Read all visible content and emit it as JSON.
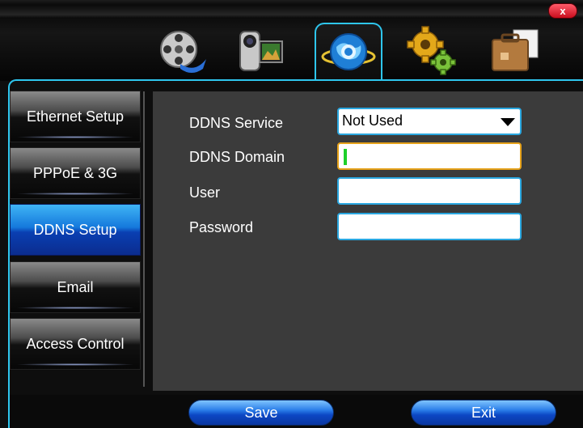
{
  "window": {
    "close_label": "x",
    "tabs": [
      {
        "name": "film-reel-icon",
        "active": false
      },
      {
        "name": "video-camera-icon",
        "active": false
      },
      {
        "name": "globe-network-icon",
        "active": true
      },
      {
        "name": "gears-icon",
        "active": false
      },
      {
        "name": "briefcase-icon",
        "active": false
      }
    ]
  },
  "sidebar": {
    "items": [
      {
        "label": "Ethernet Setup",
        "active": false
      },
      {
        "label": "PPPoE & 3G",
        "active": false
      },
      {
        "label": "DDNS Setup",
        "active": true
      },
      {
        "label": "Email",
        "active": false
      },
      {
        "label": "Access Control",
        "active": false
      }
    ]
  },
  "form": {
    "service_label": "DDNS Service",
    "service_value": "Not Used",
    "domain_label": "DDNS Domain",
    "domain_value": "",
    "user_label": "User",
    "user_value": "",
    "password_label": "Password",
    "password_value": ""
  },
  "actions": {
    "save_label": "Save",
    "exit_label": "Exit"
  },
  "colors": {
    "accent_cyan": "#2ec6ee",
    "active_blue": "#1579dc",
    "focus_orange": "#e6a21a"
  }
}
